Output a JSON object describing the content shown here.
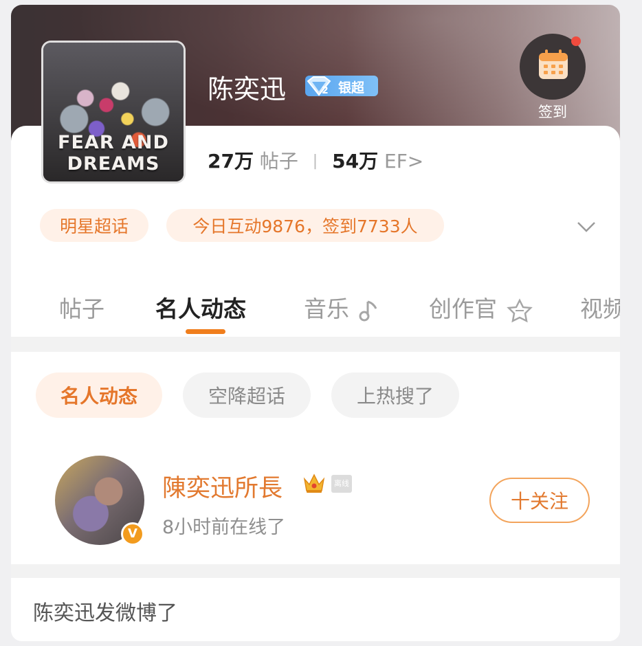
{
  "header": {
    "title": "陈奕迅",
    "level_badge": "银超",
    "level_number": "2",
    "checkin_label": "签到",
    "cover_text": "FEAR AND DREAMS"
  },
  "stats": {
    "posts_count": "27万",
    "posts_label": "帖子",
    "separator": "|",
    "ef_count": "54万",
    "ef_label": "EF>"
  },
  "tags": {
    "category": "明星超话",
    "activity": "今日互动9876，签到7733人"
  },
  "tabs": [
    {
      "label": "帖子"
    },
    {
      "label": "名人动态"
    },
    {
      "label": "音乐"
    },
    {
      "label": "创作官"
    },
    {
      "label": "视频"
    }
  ],
  "sub_tabs": [
    {
      "label": "名人动态"
    },
    {
      "label": "空降超话"
    },
    {
      "label": "上热搜了"
    }
  ],
  "celebrity": {
    "name": "陳奕迅所長",
    "offline_tag": "离线",
    "status": "8小时前在线了",
    "follow_label": "十关注",
    "verified_badge": "V"
  },
  "post": {
    "text": "陈奕迅发微博了"
  },
  "colors": {
    "accent": "#e5762a",
    "tab_underline": "#f07e1d",
    "badge_blue": "#5aa6f0",
    "notify_dot": "#ef4b3e"
  },
  "icons": [
    "calendar-icon",
    "chevron-down-icon",
    "music-note-icon",
    "creator-star-icon",
    "crown-icon",
    "diamond-icon"
  ]
}
